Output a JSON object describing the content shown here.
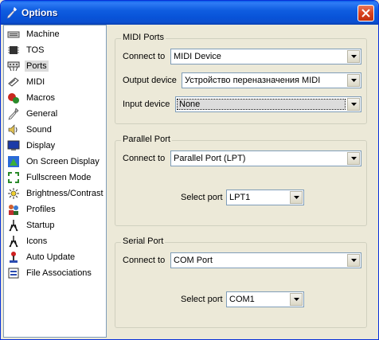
{
  "window": {
    "title": "Options"
  },
  "sidebar": {
    "items": [
      {
        "label": "Machine",
        "icon": "machine-icon"
      },
      {
        "label": "TOS",
        "icon": "chip-icon"
      },
      {
        "label": "Ports",
        "icon": "ports-icon",
        "selected": true
      },
      {
        "label": "MIDI",
        "icon": "midi-icon"
      },
      {
        "label": "Macros",
        "icon": "macros-icon"
      },
      {
        "label": "General",
        "icon": "wrench-icon"
      },
      {
        "label": "Sound",
        "icon": "speaker-icon"
      },
      {
        "label": "Display",
        "icon": "monitor-icon"
      },
      {
        "label": "On Screen Display",
        "icon": "osd-icon"
      },
      {
        "label": "Fullscreen Mode",
        "icon": "fullscreen-icon"
      },
      {
        "label": "Brightness/Contrast",
        "icon": "sun-icon"
      },
      {
        "label": "Profiles",
        "icon": "profiles-icon"
      },
      {
        "label": "Startup",
        "icon": "startup-icon"
      },
      {
        "label": "Icons",
        "icon": "icons-icon"
      },
      {
        "label": "Auto Update",
        "icon": "joystick-icon"
      },
      {
        "label": "File Associations",
        "icon": "file-assoc-icon"
      }
    ]
  },
  "midi": {
    "title": "MIDI Ports",
    "connect_label": "Connect to",
    "connect_value": "MIDI Device",
    "output_label": "Output device",
    "output_value": "Устройство переназначения MIDI",
    "input_label": "Input device",
    "input_value": "None"
  },
  "parallel": {
    "title": "Parallel Port",
    "connect_label": "Connect to",
    "connect_value": "Parallel Port (LPT)",
    "select_label": "Select port",
    "select_value": "LPT1"
  },
  "serial": {
    "title": "Serial Port",
    "connect_label": "Connect to",
    "connect_value": "COM Port",
    "select_label": "Select port",
    "select_value": "COM1"
  }
}
